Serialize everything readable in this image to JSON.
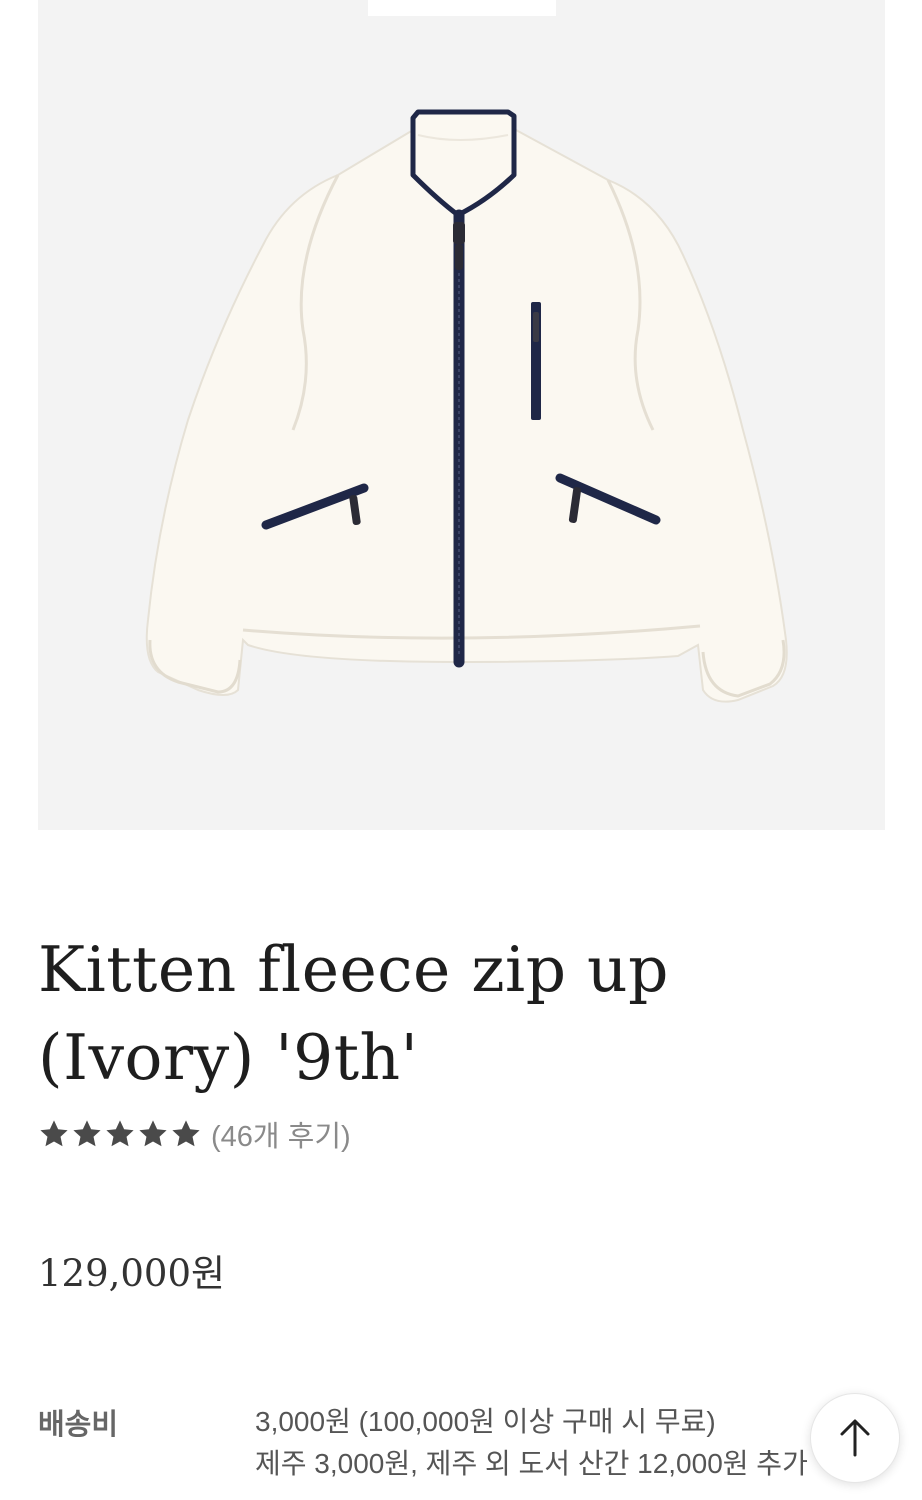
{
  "product": {
    "image_alt": "Ivory fleece zip-up jacket with navy zipper trim",
    "title": "Kitten fleece zip up (Ivory) '9th'",
    "rating": {
      "stars": 5,
      "max_stars": 5,
      "review_count_label": "(46개 후기)"
    },
    "price": "129,000원"
  },
  "shipping": {
    "label": "배송비",
    "lines": [
      "3,000원 (100,000원 이상 구매 시 무료)",
      "제주 3,000원, 제주 외 도서 산간 12,000원 추가"
    ]
  },
  "scroll_top": {
    "icon": "arrow-up-icon"
  },
  "colors": {
    "background": "#ffffff",
    "image_background": "#f3f3f3",
    "jacket": "#fbf8f1",
    "zipper_trim": "#1f2747",
    "star": "#4a4a4a",
    "muted_text": "#8a8a8a"
  }
}
